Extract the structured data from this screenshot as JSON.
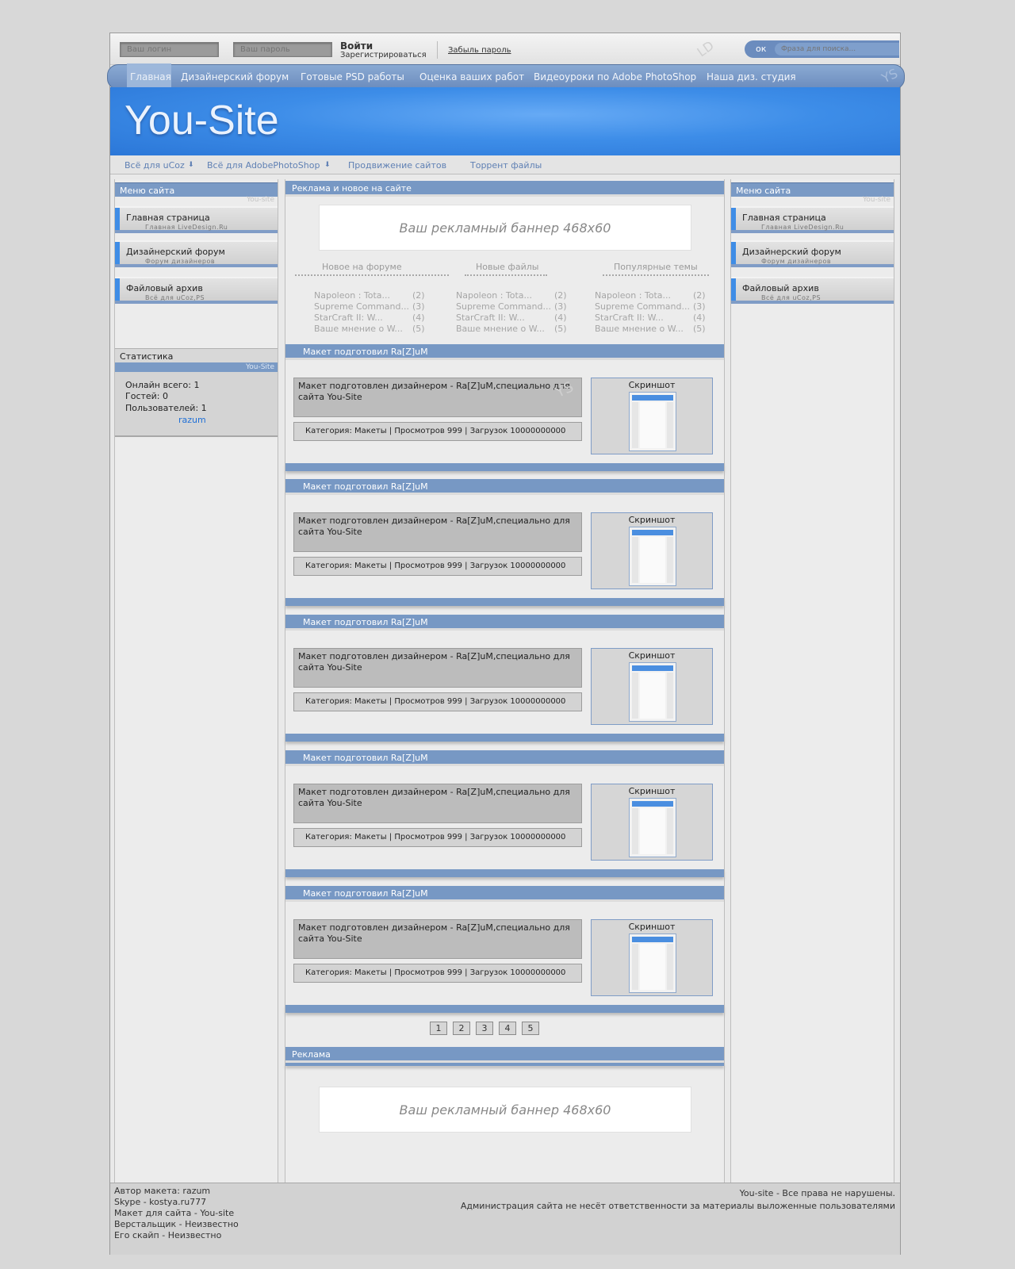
{
  "login": {
    "login_placeholder": "Ваш логин",
    "password_placeholder": "Ваш пароль",
    "enter_label": "Войти",
    "register_label": "Зарегистрироваться",
    "forgot_label": "Забыль пароль",
    "watermark": "LD"
  },
  "search": {
    "button_label": "ок",
    "placeholder": "Фраза для поиска..."
  },
  "nav": {
    "items": [
      "Главная",
      "Дизайнерский форум",
      "Готовые PSD работы",
      "Оценка ваших работ",
      "Видеоуроки по Adobe PhotoShop",
      "Наша диз. студия"
    ],
    "watermark": "YS"
  },
  "header": {
    "title": "You-Site"
  },
  "subnav": {
    "items": [
      "Всё для uCoz",
      "Всё для AdobePhotoShop",
      "Продвижение сайтов",
      "Торрент файлы"
    ]
  },
  "left_menu": {
    "title": "Меню сайта",
    "sub": "You-site",
    "items": [
      {
        "label": "Главная страница",
        "sub": "Главная LiveDesign.Ru"
      },
      {
        "label": "Дизайнерский форум",
        "sub": "Форум дизайнеров"
      },
      {
        "label": "Файловый архив",
        "sub": "Всё для uCoz,PS"
      }
    ]
  },
  "stats": {
    "title": "Статистика",
    "sub": "You-Site",
    "online": "Онлайн всего: 1",
    "guests": "Гостей: 0",
    "users": "Пользователей: 1",
    "user_link": "razum"
  },
  "right_menu": {
    "title": "Меню сайта",
    "sub": "You-site",
    "items": [
      {
        "label": "Главная страница",
        "sub": "Главная LiveDesign.Ru"
      },
      {
        "label": "Дизайнерский форум",
        "sub": "Форум дизайнеров"
      },
      {
        "label": "Файловый архив",
        "sub": "Всё для uCoz,PS"
      }
    ]
  },
  "ads_block": {
    "title": "Реклама и новое на сайте",
    "banner": "Ваш рекламный баннер 468x60",
    "columns": [
      {
        "title": "Новое на форуме",
        "items": [
          {
            "t": "Napoleon : Tota...",
            "n": "(2)"
          },
          {
            "t": "Supreme Command...",
            "n": "(3)"
          },
          {
            "t": "StarCraft II: W...",
            "n": "(4)"
          },
          {
            "t": "Ваше мнение о W...",
            "n": "(5)"
          }
        ]
      },
      {
        "title": "Новые файлы",
        "items": [
          {
            "t": "Napoleon : Tota...",
            "n": "(2)"
          },
          {
            "t": "Supreme Command...",
            "n": "(3)"
          },
          {
            "t": "StarCraft II: W...",
            "n": "(4)"
          },
          {
            "t": "Ваше мнение о W...",
            "n": "(5)"
          }
        ]
      },
      {
        "title": "Популярные темы",
        "items": [
          {
            "t": "Napoleon : Tota...",
            "n": "(2)"
          },
          {
            "t": "Supreme Command...",
            "n": "(3)"
          },
          {
            "t": "StarCraft II: W...",
            "n": "(4)"
          },
          {
            "t": "Ваше мнение о W...",
            "n": "(5)"
          }
        ]
      }
    ]
  },
  "posts": [
    {
      "title": "Макет подготовил Ra[Z]uM",
      "desc": "Макет подготовлен дизайнером - Ra[Z]uM,специально для сайта You-Site",
      "meta": "Категория: Макеты | Просмотров 999 | Загрузок 10000000000",
      "shot": "Скриншот",
      "watermark": "YS"
    },
    {
      "title": "Макет подготовил Ra[Z]uM",
      "desc": "Макет подготовлен дизайнером - Ra[Z]uM,специально для сайта You-Site",
      "meta": "Категория: Макеты | Просмотров 999 | Загрузок 10000000000",
      "shot": "Скриншот"
    },
    {
      "title": "Макет подготовил Ra[Z]uM",
      "desc": "Макет подготовлен дизайнером - Ra[Z]uM,специально для сайта You-Site",
      "meta": "Категория: Макеты | Просмотров 999 | Загрузок 10000000000",
      "shot": "Скриншот"
    },
    {
      "title": "Макет подготовил Ra[Z]uM",
      "desc": "Макет подготовлен дизайнером - Ra[Z]uM,специально для сайта You-Site",
      "meta": "Категория: Макеты | Просмотров 999 | Загрузок 10000000000",
      "shot": "Скриншот"
    },
    {
      "title": "Макет подготовил Ra[Z]uM",
      "desc": "Макет подготовлен дизайнером - Ra[Z]uM,специально для сайта You-Site",
      "meta": "Категория: Макеты | Просмотров 999 | Загрузок 10000000000",
      "shot": "Скриншот"
    }
  ],
  "pager": [
    "1",
    "2",
    "3",
    "4",
    "5"
  ],
  "ad_bottom": {
    "title": "Реклама",
    "banner": "Ваш рекламный баннер 468x60"
  },
  "footer": {
    "left": [
      "Автор макета: razum",
      "Skype - kostya.ru777",
      "Макет для сайта - You-site",
      "Верстальщик - Неизвестно",
      "Его скайп - Неизвестно"
    ],
    "right": [
      "You-site - Все права не нарушены.",
      "Администрация сайта не несёт ответственности за материалы выложенные пользователями"
    ]
  }
}
